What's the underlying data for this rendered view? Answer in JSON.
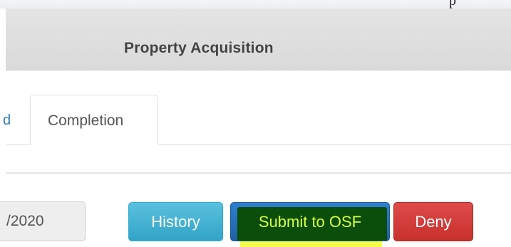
{
  "window": {
    "top_fragment_text": "p"
  },
  "header": {
    "title": "Property Acquisition"
  },
  "tabs": {
    "previous_tab_fragment": "d",
    "items": [
      {
        "label": "Completion",
        "active": true
      }
    ]
  },
  "form": {
    "date_field_value": "/2020"
  },
  "actions": {
    "history_label": "History",
    "submit_label": "Submit to OSF",
    "deny_label": "Deny"
  },
  "colors": {
    "history_button": "#5bc0de",
    "submit_button": "#2f7fd0",
    "deny_button": "#d9534f",
    "tab_link_blue": "#337ab7",
    "highlighter_yellow": "#f3ff3a"
  }
}
